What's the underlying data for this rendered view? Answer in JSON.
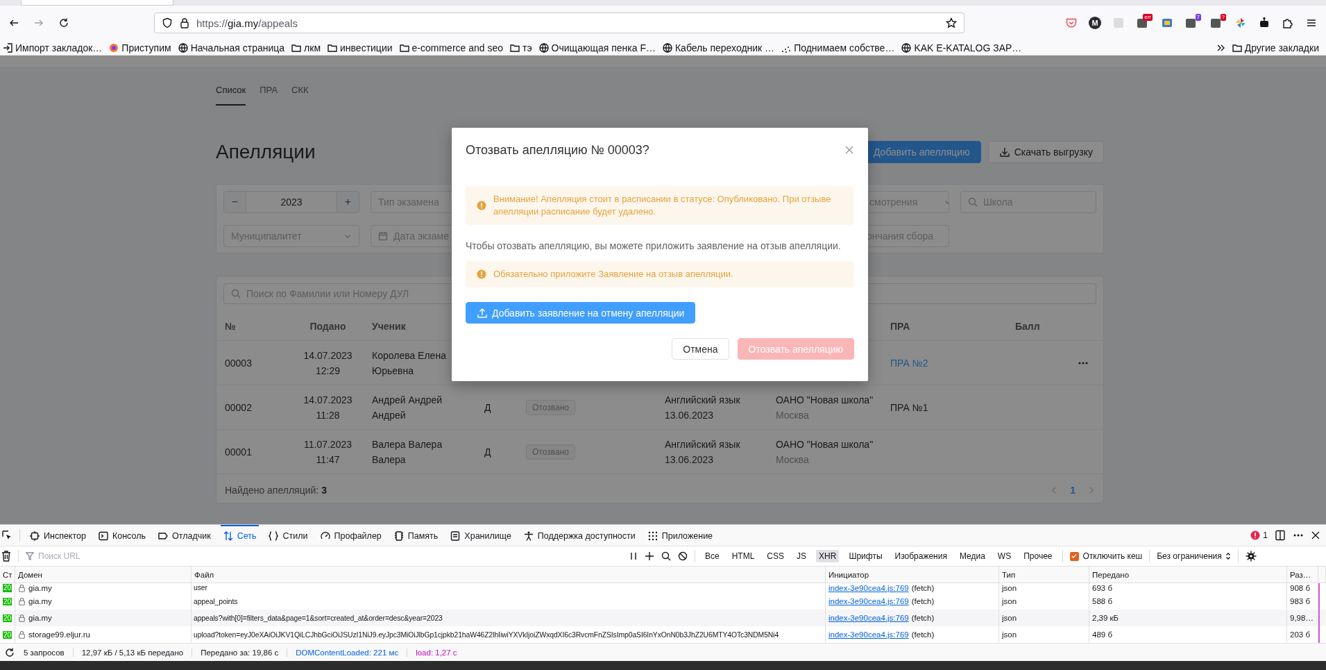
{
  "browser": {
    "address": {
      "scheme": "https://",
      "host": "gia.my",
      "path": "/appeals"
    },
    "extensions": [
      {
        "kind": "pocket"
      },
      {
        "kind": "letter",
        "label": "M"
      },
      {
        "kind": "grey"
      },
      {
        "kind": "badge",
        "badge": "err",
        "color": "#d70022"
      },
      {
        "kind": "tile"
      },
      {
        "kind": "badge",
        "badge": "7",
        "color": "#7b3fe4"
      },
      {
        "kind": "badge",
        "badge": "?",
        "color": "#d70022"
      },
      {
        "kind": "pinwheel"
      },
      {
        "kind": "robot"
      },
      {
        "kind": "puzzle"
      },
      {
        "kind": "menu"
      }
    ],
    "bookmarks": [
      {
        "label": "Импорт закладок…",
        "kind": "import"
      },
      {
        "label": "Приступим",
        "kind": "firefox"
      },
      {
        "label": "Начальная страница",
        "kind": "globe"
      },
      {
        "label": "лкм",
        "kind": "folder"
      },
      {
        "label": "инвестиции",
        "kind": "folder"
      },
      {
        "label": "e-commerce and seo",
        "kind": "folder"
      },
      {
        "label": "тэ",
        "kind": "folder"
      },
      {
        "label": "Очищающая пенка F…",
        "kind": "globe"
      },
      {
        "label": "Кабель переходник …",
        "kind": "globe"
      },
      {
        "label": "Поднимаем собстве…",
        "kind": "dots"
      },
      {
        "label": "KAK E-KATALOG ЗАР…",
        "kind": "globe"
      }
    ],
    "other_bookmarks": "Другие закладки"
  },
  "page": {
    "tabs": [
      {
        "label": "Список",
        "selected": true
      },
      {
        "label": "ПРА",
        "selected": false
      },
      {
        "label": "СКК",
        "selected": false
      }
    ],
    "title": "Апелляции",
    "actions": [
      {
        "label": "Добавить апелляцию",
        "kind": "primary"
      },
      {
        "label": "Скачать выгрузку",
        "kind": "download"
      }
    ],
    "filters": {
      "year": {
        "minus": "−",
        "value": "2023",
        "plus": "+"
      },
      "row_1": [
        {
          "kind": "select",
          "placeholder": "Тип экзамена"
        },
        {
          "kind": "select",
          "placeholder": "смотрения"
        },
        {
          "kind": "search",
          "placeholder": "Школа"
        }
      ],
      "row_2": [
        {
          "kind": "select",
          "placeholder": "Муниципалитет"
        },
        {
          "kind": "date",
          "placeholder": "Дата экзаме"
        },
        {
          "kind": "plain",
          "placeholder": "ончания сбора"
        }
      ]
    },
    "table": {
      "search": {
        "placeholder": "Поиск по Фамилии или Номеру ДУЛ"
      },
      "columns": [
        {
          "label": "№",
          "kind": "number"
        },
        {
          "label": "Подано",
          "kind": "submitted"
        },
        {
          "label": "Ученик",
          "kind": "student"
        },
        {
          "label": "ПРА",
          "kind": "pra"
        },
        {
          "label": "Балл",
          "kind": "score"
        }
      ],
      "rows": [
        {
          "number": "00003",
          "date": "14.07.2023",
          "time": "12:29",
          "student": "Королева Елена Юрьевна",
          "pra": {
            "text": "ПРА №2",
            "link": true
          },
          "menu": true
        },
        {
          "number": "00002",
          "date": "14.07.2023",
          "time": "11:28",
          "student": "Андрей Андрей Андрей",
          "form": "Д",
          "status": "Отозвано",
          "exam": "Английский язык",
          "exam_date": "13.06.2023",
          "school": "ОАНО \"Новая школа\"",
          "city": "Москва",
          "pra": {
            "text": "ПРА №1",
            "link": false
          },
          "menu": false
        },
        {
          "number": "00001",
          "date": "11.07.2023",
          "time": "11:47",
          "student": "Валера Валера Валера",
          "form": "Д",
          "status": "Отозвано",
          "exam": "Английский язык",
          "exam_date": "13.06.2023",
          "school": "ОАНО \"Новая школа\"",
          "city": "Москва",
          "menu": false
        }
      ],
      "found": "Найдено апелляций: **3**",
      "pages": [
        {
          "label": "1",
          "selected": true
        }
      ]
    }
  },
  "modal": {
    "title": "Отозвать апелляцию № 00003?",
    "body": [
      {
        "kind": "alert",
        "text": "Внимание! Апелляция стоит в расписании в статусе: Опубликовано. При отзыве апелляции расписание будет удалено."
      },
      {
        "kind": "text",
        "text": "Чтобы отозвать апелляцию, вы можете приложить заявление на отзыв апелляции."
      },
      {
        "kind": "alert",
        "text": "Обязательно приложите Заявление на отзыв апелляции."
      },
      {
        "kind": "upload",
        "text": "Добавить заявление на отмену апелляции"
      }
    ],
    "buttons": [
      {
        "label": "Отмена",
        "kind": "default",
        "disabled": false
      },
      {
        "label": "Отозвать апелляцию",
        "kind": "danger",
        "disabled": true
      }
    ]
  },
  "devtools": {
    "tabs": [
      {
        "label": "Инспектор",
        "kind": "inspector",
        "selected": false
      },
      {
        "label": "Консоль",
        "kind": "console",
        "selected": false
      },
      {
        "label": "Отладчик",
        "kind": "debugger",
        "selected": false
      },
      {
        "label": "Сеть",
        "kind": "network",
        "selected": true
      },
      {
        "label": "Стили",
        "kind": "styles",
        "selected": false
      },
      {
        "label": "Профайлер",
        "kind": "profiler",
        "selected": false
      },
      {
        "label": "Память",
        "kind": "memory",
        "selected": false
      },
      {
        "label": "Хранилище",
        "kind": "storage",
        "selected": false
      },
      {
        "label": "Поддержка доступности",
        "kind": "accessibility",
        "selected": false
      },
      {
        "label": "Приложение",
        "kind": "application",
        "selected": false
      }
    ],
    "error_count": "1",
    "filter": {
      "placeholder": "Поиск URL"
    },
    "type_filters": [
      {
        "label": "Все",
        "selected": false
      },
      {
        "label": "HTML",
        "selected": false
      },
      {
        "label": "CSS",
        "selected": false
      },
      {
        "label": "JS",
        "selected": false
      },
      {
        "label": "XHR",
        "selected": true
      },
      {
        "label": "Шрифты",
        "selected": false
      },
      {
        "label": "Изображения",
        "selected": false
      },
      {
        "label": "Медиа",
        "selected": false
      },
      {
        "label": "WS",
        "selected": false
      },
      {
        "label": "Прочее",
        "selected": false
      }
    ],
    "disable_cache": {
      "label": "Отключить кеш",
      "checked": true
    },
    "throttling": "Без ограничения",
    "columns": [
      "Ст",
      "Домен",
      "Файл",
      "Инициатор",
      "Тип",
      "Передано",
      "Раз…"
    ],
    "requests": [
      {
        "status": "20",
        "domain": "gia.my",
        "file": "user",
        "initiator": "index-3e90cea4.js:769",
        "cause": "(fetch)",
        "type": "json",
        "transferred": "693 б",
        "size": "908 б"
      },
      {
        "status": "20",
        "domain": "gia.my",
        "file": "appeal_points",
        "initiator": "index-3e90cea4.js:769",
        "cause": "(fetch)",
        "type": "json",
        "transferred": "588 б",
        "size": "983 б"
      },
      {
        "status": "20",
        "domain": "gia.my",
        "file": "appeals?with[0]=filters_data&page=1&sort=created_at&order=desc&year=2023",
        "initiator": "index-3e90cea4.js:769",
        "cause": "(fetch)",
        "type": "json",
        "transferred": "2,39 кБ",
        "size": "9,98…"
      },
      {
        "status": "20",
        "domain": "storage99.eljur.ru",
        "file": "upload?token=eyJ0eXAiOiJKV1QiLCJhbGciOiJSUzI1NiJ9.eyJpc3MiOiJlbGp1cjpkb21haW46Z2lhIiwiYXVkIjoiZWxqdXI6c3RvcmFnZSIsImp0aSI6InYxOnN0b3JhZ2U6MTY4OTc3NDM5Ni4",
        "initiator": "index-3e90cea4.js:769",
        "cause": "(fetch)",
        "type": "json",
        "transferred": "489 б",
        "size": "203 б"
      }
    ],
    "summary": [
      {
        "kind": "plain",
        "text": "5 запросов"
      },
      {
        "kind": "plain",
        "text": "12,97 кБ / 5,13 кБ передано"
      },
      {
        "kind": "plain",
        "text": "Передано за: 19,86 с"
      },
      {
        "kind": "dom",
        "text": "DOMContentLoaded: 221 мс"
      },
      {
        "kind": "load",
        "text": "load: 1,27 с"
      }
    ]
  }
}
